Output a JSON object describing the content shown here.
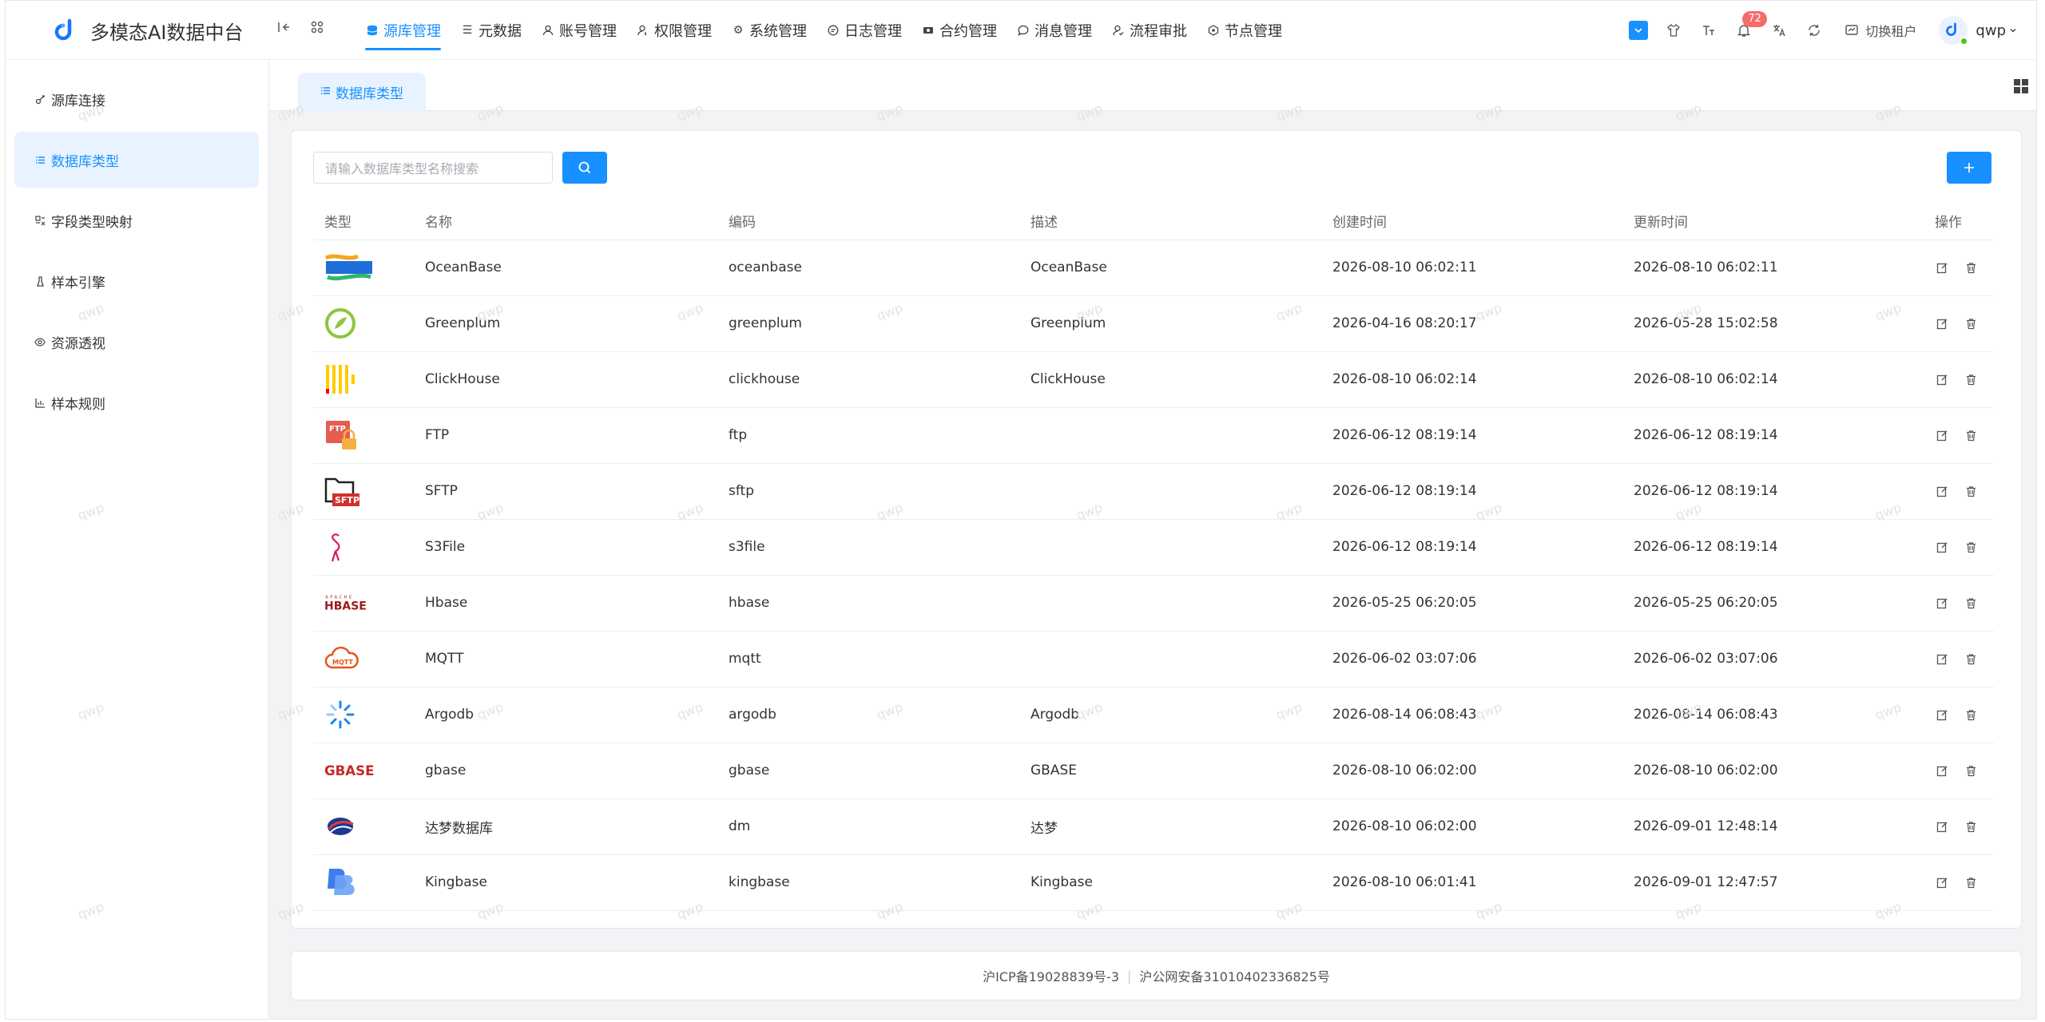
{
  "app": {
    "title": "多模态AI数据中台"
  },
  "nav": {
    "items": [
      {
        "label": "源库管理",
        "icon": "database-icon",
        "active": true
      },
      {
        "label": "元数据",
        "icon": "list-icon"
      },
      {
        "label": "账号管理",
        "icon": "user-icon"
      },
      {
        "label": "权限管理",
        "icon": "user-key-icon"
      },
      {
        "label": "系统管理",
        "icon": "gear-icon"
      },
      {
        "label": "日志管理",
        "icon": "log-icon"
      },
      {
        "label": "合约管理",
        "icon": "contract-icon"
      },
      {
        "label": "消息管理",
        "icon": "message-icon"
      },
      {
        "label": "流程审批",
        "icon": "approval-icon"
      },
      {
        "label": "节点管理",
        "icon": "node-icon"
      }
    ]
  },
  "toolbar": {
    "notification_count": "72",
    "switch_tenant_label": "切换租户",
    "username": "qwp"
  },
  "sidebar": {
    "items": [
      {
        "label": "源库连接",
        "icon": "link-icon"
      },
      {
        "label": "数据库类型",
        "icon": "list-icon",
        "active": true
      },
      {
        "label": "字段类型映射",
        "icon": "mapping-icon"
      },
      {
        "label": "样本引擎",
        "icon": "engine-icon"
      },
      {
        "label": "资源透视",
        "icon": "eye-icon"
      },
      {
        "label": "样本规则",
        "icon": "rule-icon"
      }
    ]
  },
  "tab": {
    "label": "数据库类型"
  },
  "search": {
    "placeholder": "请输入数据库类型名称搜索"
  },
  "table": {
    "headers": [
      "类型",
      "名称",
      "编码",
      "描述",
      "创建时间",
      "更新时间",
      "操作"
    ],
    "rows": [
      {
        "logo": "oceanbase-logo",
        "name": "OceanBase",
        "code": "oceanbase",
        "desc": "OceanBase",
        "created": "2026-08-10 06:02:11",
        "updated": "2026-08-10 06:02:11"
      },
      {
        "logo": "greenplum-logo",
        "name": "Greenplum",
        "code": "greenplum",
        "desc": "Greenplum",
        "created": "2026-04-16 08:20:17",
        "updated": "2026-05-28 15:02:58"
      },
      {
        "logo": "clickhouse-logo",
        "name": "ClickHouse",
        "code": "clickhouse",
        "desc": "ClickHouse",
        "created": "2026-08-10 06:02:14",
        "updated": "2026-08-10 06:02:14"
      },
      {
        "logo": "ftp-logo",
        "name": "FTP",
        "code": "ftp",
        "desc": "",
        "created": "2026-06-12 08:19:14",
        "updated": "2026-06-12 08:19:14"
      },
      {
        "logo": "sftp-logo",
        "name": "SFTP",
        "code": "sftp",
        "desc": "",
        "created": "2026-06-12 08:19:14",
        "updated": "2026-06-12 08:19:14"
      },
      {
        "logo": "s3file-logo",
        "name": "S3File",
        "code": "s3file",
        "desc": "",
        "created": "2026-06-12 08:19:14",
        "updated": "2026-06-12 08:19:14"
      },
      {
        "logo": "hbase-logo",
        "name": "Hbase",
        "code": "hbase",
        "desc": "",
        "created": "2026-05-25 06:20:05",
        "updated": "2026-05-25 06:20:05"
      },
      {
        "logo": "mqtt-logo",
        "name": "MQTT",
        "code": "mqtt",
        "desc": "",
        "created": "2026-06-02 03:07:06",
        "updated": "2026-06-02 03:07:06"
      },
      {
        "logo": "argodb-logo",
        "name": "Argodb",
        "code": "argodb",
        "desc": "Argodb",
        "created": "2026-08-14 06:08:43",
        "updated": "2026-08-14 06:08:43"
      },
      {
        "logo": "gbase-logo",
        "name": "gbase",
        "code": "gbase",
        "desc": "GBASE",
        "created": "2026-08-10 06:02:00",
        "updated": "2026-08-10 06:02:00"
      },
      {
        "logo": "dm-logo",
        "name": "达梦数据库",
        "code": "dm",
        "desc": "达梦",
        "created": "2026-08-10 06:02:00",
        "updated": "2026-09-01 12:48:14"
      },
      {
        "logo": "kingbase-logo",
        "name": "Kingbase",
        "code": "kingbase",
        "desc": "Kingbase",
        "created": "2026-08-10 06:01:41",
        "updated": "2026-09-01 12:47:57"
      }
    ]
  },
  "logo_text": {
    "ftp": "FTP",
    "sftp": "SFTP",
    "hbase_top": "APACHE",
    "hbase": "HBASE",
    "mqtt": "MQTT",
    "gbase": "GBASE"
  },
  "footer": {
    "icp": "沪ICP备19028839号-3",
    "police": "沪公网安备31010402336825号"
  },
  "watermark": "qwp",
  "colors": {
    "accent": "#1890ff",
    "badge": "#f56c6c"
  }
}
